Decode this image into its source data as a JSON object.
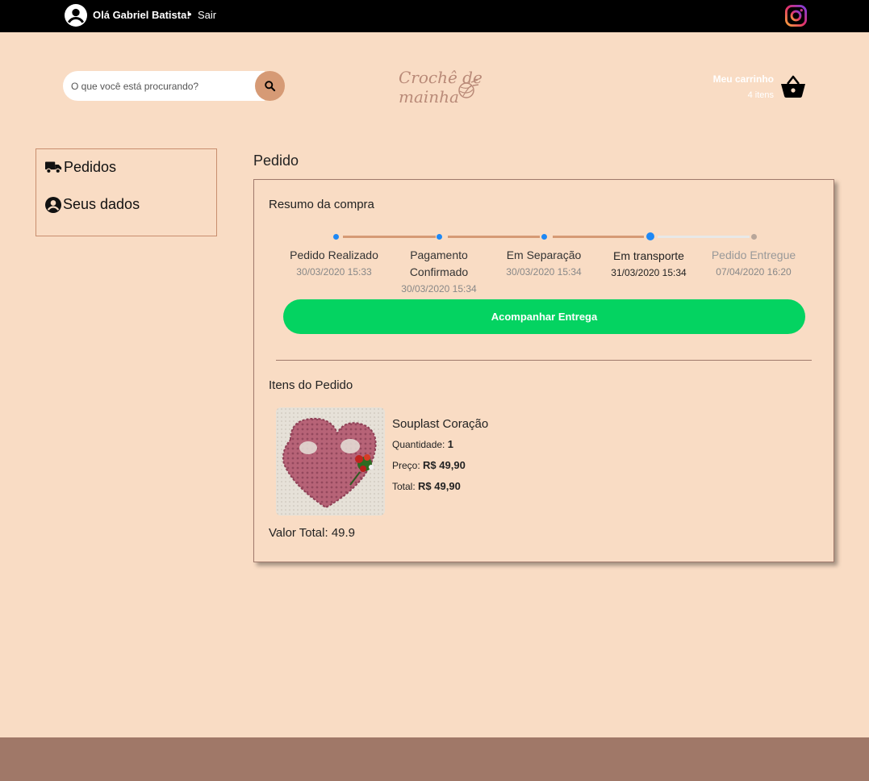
{
  "topbar": {
    "greeting": "Olá Gabriel Batista!",
    "separator": "•",
    "logout_label": "Sair"
  },
  "header": {
    "search_placeholder": "O que você está procurando?",
    "logo_line1": "Crochê de",
    "logo_line2": "mainha",
    "cart_title": "Meu carrinho",
    "cart_count": "4 itens"
  },
  "sidebar": {
    "items": [
      {
        "label": "Pedidos",
        "icon": "truck-icon"
      },
      {
        "label": "Seus dados",
        "icon": "user-circle-icon"
      }
    ]
  },
  "order": {
    "page_title": "Pedido",
    "summary_title": "Resumo da compra",
    "steps": [
      {
        "label": "Pedido Realizado",
        "date": "30/03/2020 15:33",
        "done": true
      },
      {
        "label": "Pagamento Confirmado",
        "date": "30/03/2020 15:34",
        "done": true
      },
      {
        "label": "Em Separação",
        "date": "30/03/2020 15:34",
        "done": true
      },
      {
        "label": "Em transporte",
        "date": "31/03/2020 15:34",
        "done": true,
        "current": true
      },
      {
        "label": "Pedido Entregue",
        "date": "07/04/2020 16:20",
        "done": false
      }
    ],
    "track_button": "Acompanhar Entrega",
    "items_title": "Itens do Pedido",
    "items": [
      {
        "name": "Souplast Coração",
        "quantity_label": "Quantidade:",
        "quantity": "1",
        "price_label": "Preço:",
        "price": "R$ 49,90",
        "total_label": "Total:",
        "total": "R$ 49,90"
      }
    ],
    "grand_total": "Valor Total: 49.9"
  },
  "colors": {
    "background": "#f9dcc4",
    "accent": "#d69a75",
    "success": "#04d361",
    "step_dot": "#1e88f5",
    "footer": "#a07868"
  }
}
